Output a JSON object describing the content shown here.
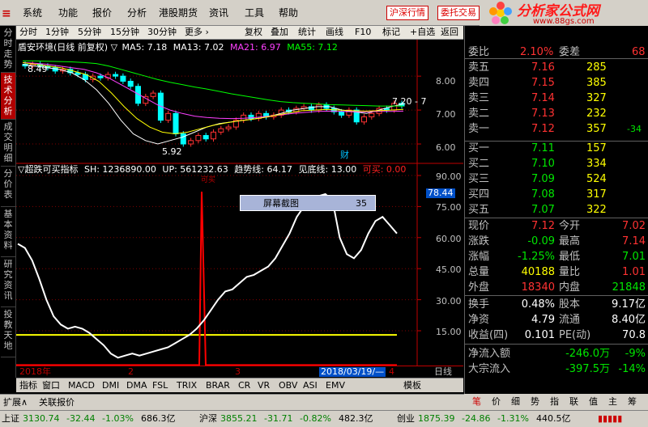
{
  "menu": {
    "items": [
      "系统",
      "功能",
      "报价",
      "分析",
      "港股期货",
      "资讯",
      "工具",
      "帮助"
    ],
    "red_buttons": [
      "沪深行情",
      "委托交易"
    ]
  },
  "brand": {
    "name": "分析家公式网",
    "url": "www.88gs.com"
  },
  "toolbar": {
    "periods": [
      "分时",
      "1分钟",
      "5分钟",
      "15分钟",
      "30分钟",
      "更多 ›"
    ],
    "actions": [
      "复权",
      "叠加",
      "统计",
      "画线",
      "F10",
      "标记",
      "+自选",
      "返回"
    ]
  },
  "left_tabs": [
    {
      "label": "分时走势",
      "active": false
    },
    {
      "label": "技术分析",
      "active": true
    },
    {
      "label": "成交明细",
      "active": false
    },
    {
      "label": "分价表",
      "active": false
    },
    {
      "label": "基本资料",
      "active": false
    },
    {
      "label": "研究资讯",
      "active": false
    },
    {
      "label": "投教天地",
      "active": false
    }
  ],
  "main_chart": {
    "legend_title": "盾安环境(日线 前复权) ▽",
    "ma": [
      {
        "label": "MA5: 7.18",
        "color": "#ffffff"
      },
      {
        "label": "MA13: 7.02",
        "color": "#ffffff"
      },
      {
        "label": "MA21: 6.97",
        "color": "#ff40ff"
      },
      {
        "label": "MA55: 7.12",
        "color": "#00ff00"
      }
    ],
    "high_label": "8.49",
    "low_label": "5.92",
    "right_label": "7.20 - 7",
    "event_label": "财",
    "price_ticks": [
      "8.00",
      "7.00",
      "6.00"
    ]
  },
  "indicator": {
    "legend": [
      {
        "text": "▽超跌可买指标",
        "color": "#ffffff"
      },
      {
        "text": "SH: 1236890.00",
        "color": "#ffffff"
      },
      {
        "text": "UP: 561232.63",
        "color": "#ffffff"
      },
      {
        "text": "趋势线: 64.17",
        "color": "#ffffff"
      },
      {
        "text": "见底线: 13.00",
        "color": "#ffffff"
      },
      {
        "text": "可买: 0.00",
        "color": "#ff0000"
      }
    ],
    "spike_label": "可买",
    "ticks": [
      "90.00",
      "75.00",
      "60.00",
      "45.00",
      "30.00",
      "15.00"
    ],
    "current_value": "78.44",
    "screenshot_label": "屏幕截图",
    "screenshot_value": "35"
  },
  "time_axis": {
    "labels": [
      "2018年",
      "2",
      "3",
      "4"
    ],
    "cursor_date": "2018/03/19/—",
    "period": "日线"
  },
  "bottom_tabs": [
    "指标",
    "窗口",
    "MACD",
    "DMI",
    "DMA",
    "FSL",
    "TRIX",
    "BRAR",
    "CR",
    "VR",
    "OBV",
    "ASI",
    "EMV"
  ],
  "bottom_right": "模板",
  "expand": {
    "expand_label": "扩展∧",
    "related": "关联报价"
  },
  "quote": {
    "webi": {
      "label": "委比",
      "value": "2.10%",
      "diff_label": "委差",
      "diff": "68"
    },
    "sells": [
      {
        "label": "卖五",
        "price": "7.16",
        "vol": "285",
        "chg": ""
      },
      {
        "label": "卖四",
        "price": "7.15",
        "vol": "385",
        "chg": ""
      },
      {
        "label": "卖三",
        "price": "7.14",
        "vol": "327",
        "chg": ""
      },
      {
        "label": "卖二",
        "price": "7.13",
        "vol": "232",
        "chg": ""
      },
      {
        "label": "卖一",
        "price": "7.12",
        "vol": "357",
        "chg": "-34"
      }
    ],
    "buys": [
      {
        "label": "买一",
        "price": "7.11",
        "vol": "157"
      },
      {
        "label": "买二",
        "price": "7.10",
        "vol": "334"
      },
      {
        "label": "买三",
        "price": "7.09",
        "vol": "524"
      },
      {
        "label": "买四",
        "price": "7.08",
        "vol": "317"
      },
      {
        "label": "买五",
        "price": "7.07",
        "vol": "322"
      }
    ],
    "stats": [
      {
        "l1": "现价",
        "v1": "7.12",
        "c1": "red",
        "l2": "今开",
        "v2": "7.02",
        "c2": "red"
      },
      {
        "l1": "涨跌",
        "v1": "-0.09",
        "c1": "grn",
        "l2": "最高",
        "v2": "7.14",
        "c2": "red"
      },
      {
        "l1": "涨幅",
        "v1": "-1.25%",
        "c1": "grn",
        "l2": "最低",
        "v2": "7.01",
        "c2": "grn"
      },
      {
        "l1": "总量",
        "v1": "40188",
        "c1": "yel",
        "l2": "量比",
        "v2": "1.01",
        "c2": "red"
      },
      {
        "l1": "外盘",
        "v1": "18340",
        "c1": "red",
        "l2": "内盘",
        "v2": "21848",
        "c2": "grn"
      }
    ],
    "stats2": [
      {
        "l1": "换手",
        "v1": "0.48%",
        "l2": "股本",
        "v2": "9.17亿"
      },
      {
        "l1": "净资",
        "v1": "4.79",
        "l2": "流通",
        "v2": "8.40亿"
      },
      {
        "l1": "收益(四)",
        "v1": "0.101",
        "l2": "PE(动)",
        "v2": "70.8"
      }
    ],
    "flows": [
      {
        "label": "净流入额",
        "value": "-246.0万",
        "pct": "-9%"
      },
      {
        "label": "大宗流入",
        "value": "-397.5万",
        "pct": "-14%"
      }
    ]
  },
  "quote_tabs": [
    "笔",
    "价",
    "细",
    "势",
    "指",
    "联",
    "值",
    "主",
    "筹"
  ],
  "status": [
    {
      "name": "上证",
      "value": "3130.74",
      "chg": "-32.44",
      "pct": "-1.03%",
      "amt": "686.3亿"
    },
    {
      "name": "沪深",
      "value": "3855.21",
      "chg": "-31.71",
      "pct": "-0.82%",
      "amt": "482.3亿"
    },
    {
      "name": "创业",
      "value": "1875.39",
      "chg": "-24.86",
      "pct": "-1.31%",
      "amt": "440.5亿"
    }
  ],
  "chart_data": {
    "type": "line",
    "series": [
      {
        "name": "MA5",
        "values": [
          8.35,
          8.3,
          8.25,
          8.2,
          8.1,
          7.9,
          7.6,
          7.2,
          6.7,
          6.3,
          6.1,
          6.0,
          6.1,
          6.2,
          6.35,
          6.5,
          6.6,
          6.65,
          6.7,
          6.75,
          6.8,
          6.9,
          7.0,
          7.05,
          7.1,
          7.1,
          7.0,
          6.95,
          6.9,
          7.0,
          7.1,
          7.18
        ]
      },
      {
        "name": "MA21",
        "values": [
          8.4,
          8.38,
          8.35,
          8.3,
          8.25,
          8.2,
          8.1,
          7.95,
          7.75,
          7.55,
          7.35,
          7.15,
          7.0,
          6.9,
          6.82,
          6.78,
          6.76,
          6.75,
          6.76,
          6.78,
          6.82,
          6.86,
          6.9,
          6.93,
          6.96,
          6.97,
          6.96,
          6.95,
          6.95,
          6.96,
          6.96,
          6.97
        ]
      },
      {
        "name": "MA55",
        "values": [
          8.45,
          8.45,
          8.44,
          8.43,
          8.42,
          8.4,
          8.37,
          8.3,
          8.2,
          8.1,
          8.0,
          7.9,
          7.82,
          7.75,
          7.68,
          7.62,
          7.55,
          7.48,
          7.42,
          7.36,
          7.3,
          7.25,
          7.22,
          7.2,
          7.18,
          7.16,
          7.15,
          7.14,
          7.13,
          7.12,
          7.12,
          7.12
        ]
      },
      {
        "name": "趋势线",
        "values": [
          57,
          55,
          49,
          40,
          30,
          22,
          18,
          16,
          17,
          16,
          14,
          11,
          8,
          4,
          2,
          3,
          4,
          3,
          4,
          5,
          6,
          7,
          9,
          11,
          13,
          16,
          20,
          25,
          30,
          34,
          35,
          38,
          41,
          42,
          44,
          46,
          50,
          56,
          62,
          70,
          75,
          78,
          80,
          81,
          78,
          60,
          52,
          50,
          54,
          62,
          68,
          70,
          66,
          62
        ]
      }
    ],
    "ylim": [
      0,
      95
    ],
    "price_ylim": [
      5.5,
      8.6
    ]
  }
}
